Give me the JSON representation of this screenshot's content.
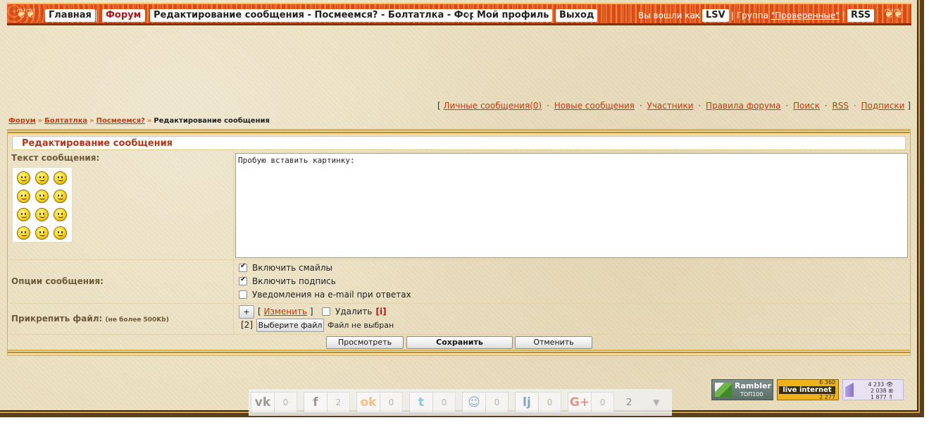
{
  "nav": {
    "home": "Главная",
    "forum": "Форум",
    "topic": "Редактирование сообщения - Посмеемся? - Болтатлка - Форум",
    "profile": "Мой профиль",
    "logout": "Выход",
    "logged_as": "Вы вошли как",
    "username": "LSV",
    "group_prefix": "| Группа ",
    "group_name": "\"Проверенные\"",
    "group_suffix": " |",
    "rss": "RSS"
  },
  "links": {
    "open": "[",
    "messages": "Личные сообщения(0)",
    "new": "Новые сообщения",
    "members": "Участники",
    "rules": "Правила форума",
    "search": "Поиск",
    "rss": "RSS",
    "subs": "Подписки",
    "close": "]",
    "dot": "·"
  },
  "breadcrumb": {
    "forum": "Форум",
    "chat": "Болтатлка",
    "topic": "Посмеемся?",
    "current": "Редактирование сообщения",
    "arrow": "»"
  },
  "form": {
    "title": "Редактирование сообщения",
    "text_label": "Текст сообщения:",
    "message": "Пробую вставить картинку:",
    "options_label": "Опции сообщения:",
    "opt_smileys": "Включить смайлы",
    "opt_signature": "Включить подпись",
    "opt_email": "Уведомления на e-mail при ответах",
    "attach_label": "Прикрепить файл:",
    "attach_note": "(не более 500Kb)",
    "plus": "+",
    "change_open": "[",
    "change": "Изменить",
    "change_close": "]",
    "delete": "Удалить",
    "info": "[i]",
    "file_index": "[2]",
    "choose_file": "Выберите файл",
    "no_file": "Файл не выбран",
    "preview": "Просмотреть",
    "save": "Сохранить",
    "cancel": "Отменить"
  },
  "counters": {
    "rambler_title": "Rambler",
    "rambler_sub": "ТОП100",
    "li_top": "6 360",
    "li_mid": "live internet",
    "li_bot": "2 277",
    "li_s1": "4 233 👁",
    "li_s2": "2 038 ⊞",
    "li_s3": "1 877 ⇑"
  },
  "share": {
    "buttons": [
      {
        "icon": "vk-icon",
        "glyph": "vk",
        "count": "0"
      },
      {
        "icon": "facebook-icon",
        "glyph": "f",
        "count": "2"
      },
      {
        "icon": "odnoklassniki-icon",
        "glyph": "ok",
        "count": "0"
      },
      {
        "icon": "twitter-icon",
        "glyph": "t",
        "count": "0"
      },
      {
        "icon": "moimir-icon",
        "glyph": "☺",
        "count": "0"
      },
      {
        "icon": "livejournal-icon",
        "glyph": "lj",
        "count": "0"
      },
      {
        "icon": "googleplus-icon",
        "glyph": "G+",
        "count": "0"
      }
    ],
    "total": "2"
  },
  "colors": {
    "accent_red": "#b4121b",
    "link": "#c33a13",
    "topbar": "#d94a16"
  }
}
